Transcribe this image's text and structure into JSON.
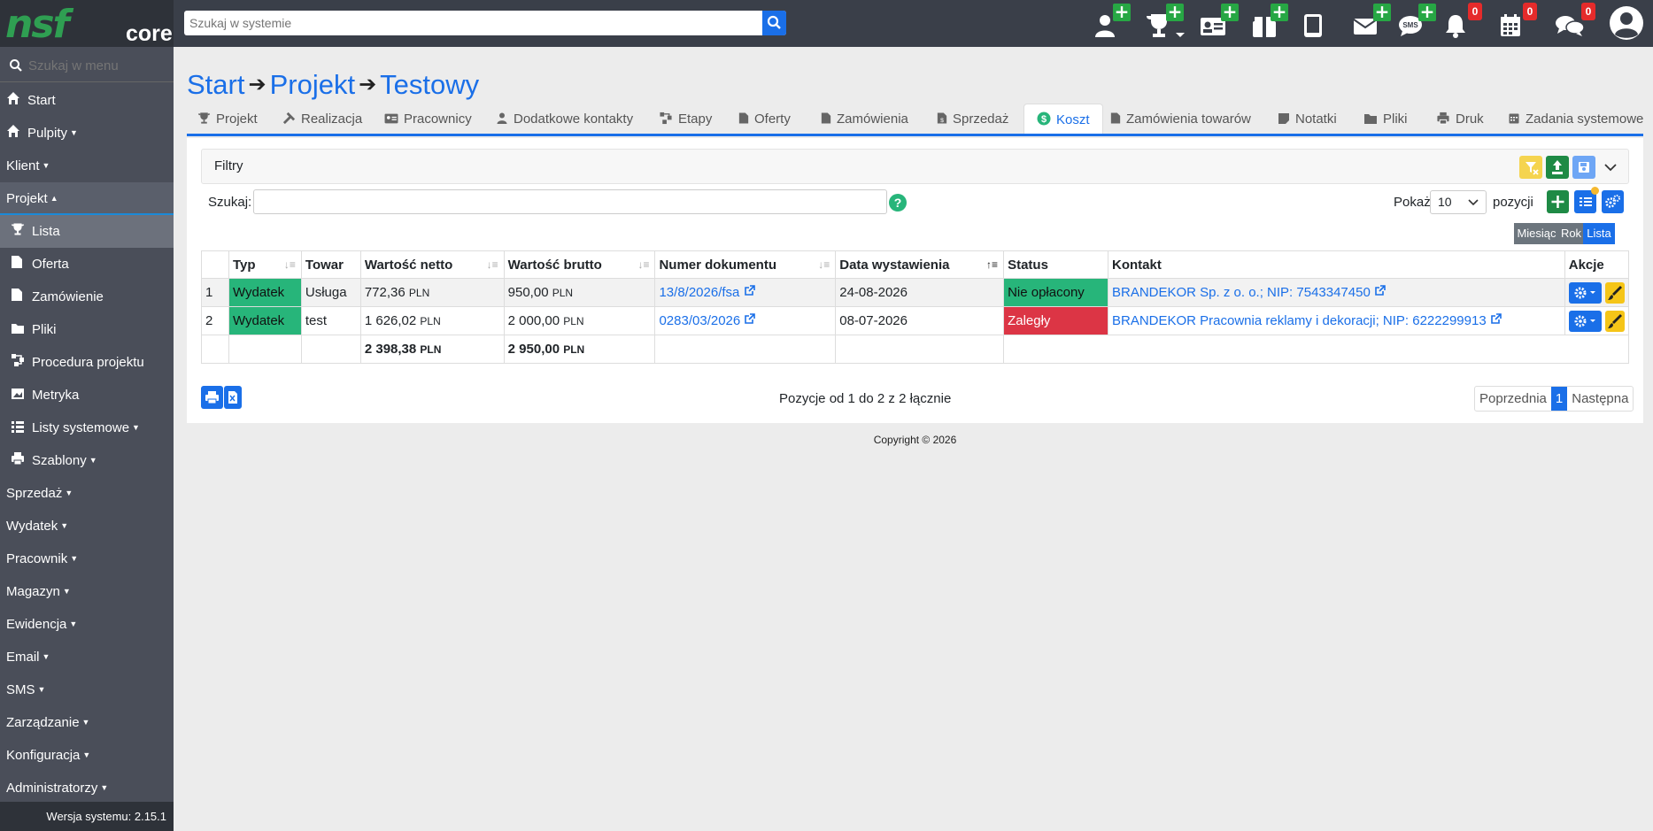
{
  "topbar": {
    "logo_nsf": "nsf",
    "logo_core": "core",
    "search_placeholder": "Szukaj w systemie",
    "notifications_count": "0",
    "calendar_count": "0",
    "chat_count": "0"
  },
  "sidebar": {
    "search_placeholder": "Szukaj w menu",
    "items": [
      {
        "label": "Start"
      },
      {
        "label": "Pulpity"
      },
      {
        "label": "Klient"
      },
      {
        "label": "Projekt"
      },
      {
        "label": "Lista"
      },
      {
        "label": "Oferta"
      },
      {
        "label": "Zamówienie"
      },
      {
        "label": "Pliki"
      },
      {
        "label": "Procedura projektu"
      },
      {
        "label": "Metryka"
      },
      {
        "label": "Listy systemowe"
      },
      {
        "label": "Szablony"
      },
      {
        "label": "Sprzedaż"
      },
      {
        "label": "Wydatek"
      },
      {
        "label": "Pracownik"
      },
      {
        "label": "Magazyn"
      },
      {
        "label": "Ewidencja"
      },
      {
        "label": "Email"
      },
      {
        "label": "SMS"
      },
      {
        "label": "Zarządzanie"
      },
      {
        "label": "Konfiguracja"
      },
      {
        "label": "Administratorzy"
      }
    ],
    "version": "Wersja systemu: 2.15.1"
  },
  "breadcrumb": [
    "Start",
    "Projekt",
    "Testowy"
  ],
  "tabs": [
    "Projekt",
    "Realizacja",
    "Pracownicy",
    "Dodatkowe kontakty",
    "Etapy",
    "Oferty",
    "Zamówienia",
    "Sprzedaż",
    "Koszt",
    "Zamówienia towarów",
    "Notatki",
    "Pliki",
    "Druk",
    "Zadania systemowe"
  ],
  "filters": {
    "label": "Filtry"
  },
  "search": {
    "label": "Szukaj:",
    "help": "?"
  },
  "page_size": {
    "label_before": "Pokaż",
    "value": "10",
    "label_after": "pozycji"
  },
  "period": [
    "Miesiąc",
    "Rok",
    "Lista"
  ],
  "table": {
    "headers": [
      "",
      "Typ",
      "Towar",
      "Wartość netto",
      "Wartość brutto",
      "Numer dokumentu",
      "Data wystawienia",
      "Status",
      "Kontakt",
      "Akcje"
    ],
    "rows": [
      {
        "no": "1",
        "typ": "Wydatek",
        "towar": "Usługa",
        "netto": "772,36",
        "brutto": "950,00",
        "currency": "PLN",
        "doc": "13/8/2026/fsa",
        "date": "24-08-2026",
        "status": "Nie opłacony",
        "contact": "BRANDEKOR Sp. z o. o.; NIP: 7543347450"
      },
      {
        "no": "2",
        "typ": "Wydatek",
        "towar": "test",
        "netto": "1 626,02",
        "brutto": "2 000,00",
        "currency": "PLN",
        "doc": "0283/03/2026",
        "date": "08-07-2026",
        "status": "Zaległy",
        "contact": "BRANDEKOR Pracownia reklamy i dekoracji; NIP: 6222299913"
      }
    ],
    "totals": {
      "netto": "2 398,38",
      "brutto": "2 950,00",
      "currency": "PLN"
    }
  },
  "footer": {
    "info": "Pozycje od 1 do 2 z 2 łącznie",
    "prev": "Poprzednia",
    "page": "1",
    "next": "Następna"
  },
  "copyright": "Copyright © 2026"
}
